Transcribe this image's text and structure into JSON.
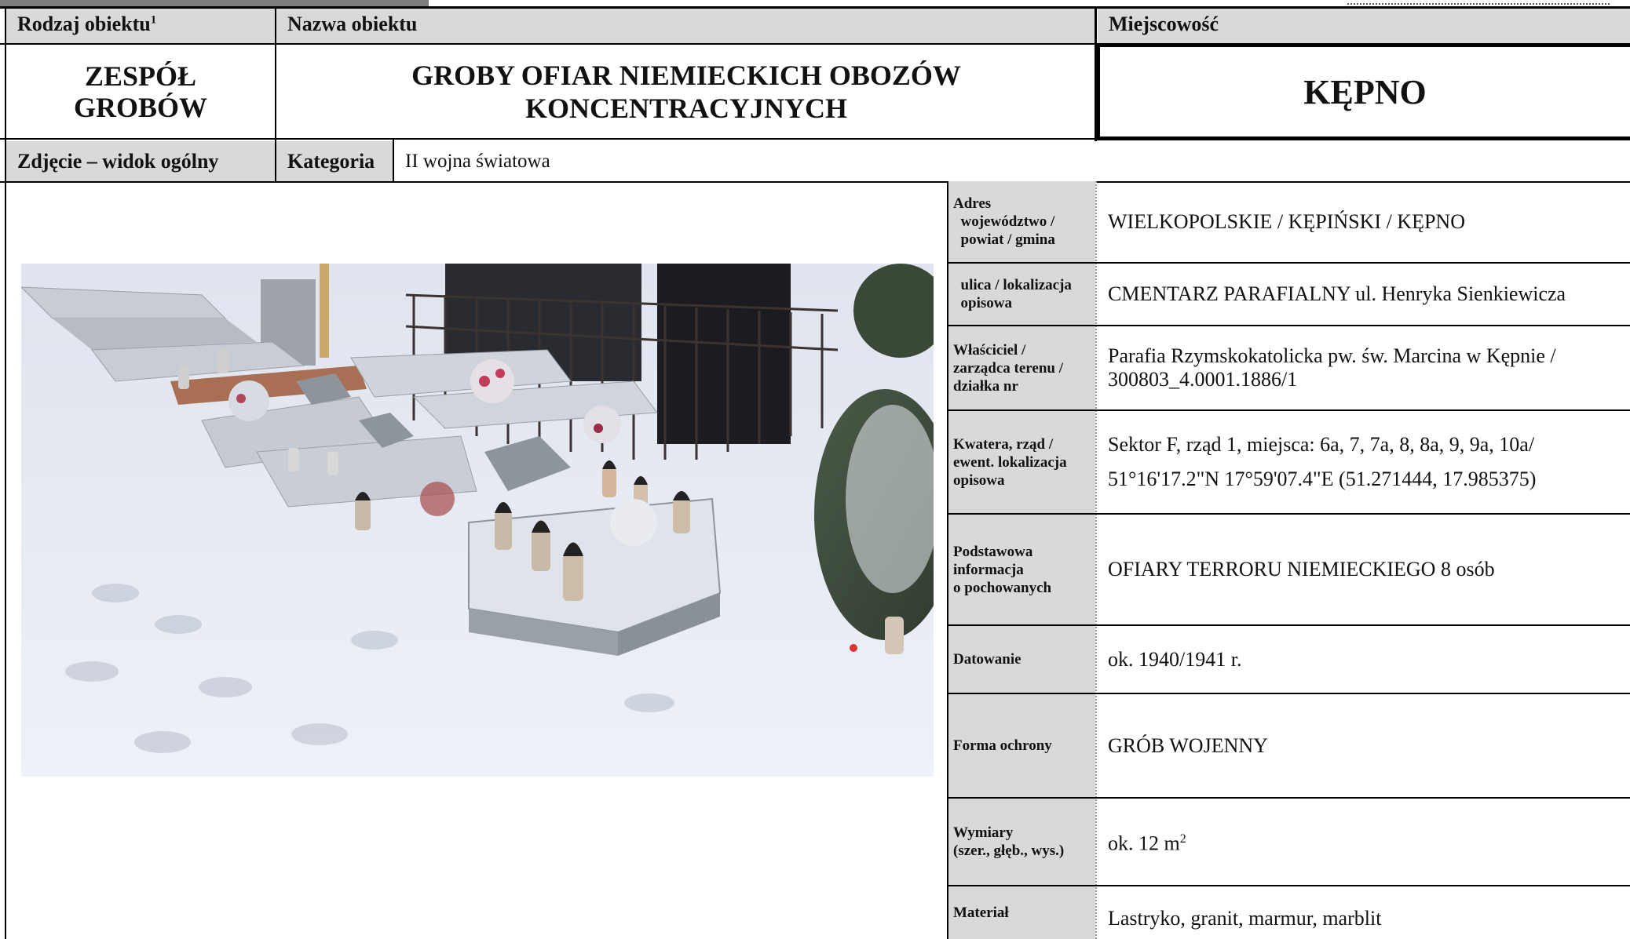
{
  "header": {
    "rodzaj_label": "Rodzaj obiektu",
    "rodzaj_sup": "1",
    "nazwa_label": "Nazwa obiektu",
    "miejscowosc_label": "Miejscowość"
  },
  "values": {
    "rodzaj_line1": "ZESPÓŁ",
    "rodzaj_line2": "GROBÓW",
    "nazwa_line1": "GROBY OFIAR NIEMIECKICH OBOZÓW",
    "nazwa_line2": "KONCENTRACYJNYCH",
    "miejscowosc": "KĘPNO"
  },
  "row3": {
    "zdjecie_label": "Zdjęcie – widok ogólny",
    "kategoria_label": "Kategoria",
    "kategoria_value": "II wojna światowa"
  },
  "details": [
    {
      "label_lines": [
        "Adres",
        "  województwo /",
        "  powiat / gmina"
      ],
      "value_lines": [
        "WIELKOPOLSKIE / KĘPIŃSKI / KĘPNO"
      ]
    },
    {
      "label_lines": [
        "  ulica / lokalizacja",
        "  opisowa"
      ],
      "value_lines": [
        "CMENTARZ PARAFIALNY ul. Henryka Sienkiewicza"
      ]
    },
    {
      "label_lines": [
        "Właściciel /",
        "zarządca terenu /",
        "działka nr"
      ],
      "value_lines": [
        "Parafia Rzymskokatolicka pw. św. Marcina w Kępnie /",
        "300803_4.0001.1886/1"
      ]
    },
    {
      "label_lines": [
        "Kwatera, rząd /",
        "ewent. lokalizacja",
        "opisowa"
      ],
      "value_lines": [
        "Sektor F, rząd 1, miejsca: 6a, 7, 7a, 8, 8a, 9, 9a, 10a/",
        "51°16'17.2\"N 17°59'07.4\"E (51.271444, 17.985375)"
      ]
    },
    {
      "label_lines": [
        "Podstawowa",
        "informacja",
        "o pochowanych"
      ],
      "value_lines": [
        "OFIARY TERRORU NIEMIECKIEGO 8 osób"
      ]
    },
    {
      "label_lines": [
        "Datowanie"
      ],
      "value_lines": [
        "ok. 1940/1941 r."
      ]
    },
    {
      "label_lines": [
        "Forma ochrony"
      ],
      "value_lines": [
        "GRÓB WOJENNY"
      ]
    },
    {
      "label_lines": [
        "Wymiary",
        "(szer., głęb., wys.)"
      ],
      "value_lines": [
        "ok. 12 m"
      ],
      "value_sup": "2"
    },
    {
      "label_lines": [
        "Materiał"
      ],
      "value_lines": [
        "Lastryko, granit, marmur, marblit"
      ]
    }
  ]
}
